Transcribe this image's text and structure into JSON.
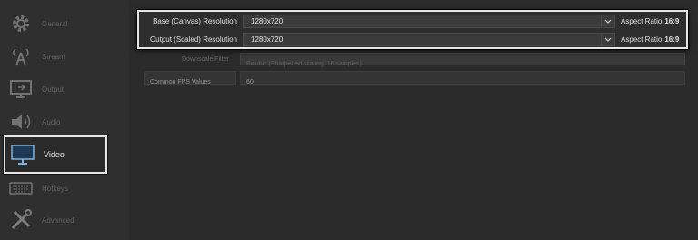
{
  "sidebar": {
    "items": [
      {
        "label": "General",
        "icon": "gear-icon"
      },
      {
        "label": "Stream",
        "icon": "broadcast-tower-icon"
      },
      {
        "label": "Output",
        "icon": "output-monitor-icon"
      },
      {
        "label": "Audio",
        "icon": "speaker-icon"
      },
      {
        "label": "Video",
        "icon": "monitor-icon",
        "active": true
      },
      {
        "label": "Hotkeys",
        "icon": "keyboard-icon"
      },
      {
        "label": "Advanced",
        "icon": "tools-icon"
      }
    ]
  },
  "video": {
    "base_label": "Base (Canvas) Resolution",
    "base_value": "1280x720",
    "base_aspect_label": "Aspect Ratio",
    "base_aspect_value": "16:9",
    "output_label": "Output (Scaled) Resolution",
    "output_value": "1280x720",
    "output_aspect_label": "Aspect Ratio",
    "output_aspect_value": "16:9",
    "downscale_label": "Downscale Filter",
    "downscale_value": "Bicubic (Sharpened scaling, 16 samples)",
    "fps_label": "Common FPS Values",
    "fps_value": "60"
  },
  "colors": {
    "highlight_border": "#e6e6e6",
    "background": "#2b2b2b",
    "field": "#3b3b3b"
  }
}
